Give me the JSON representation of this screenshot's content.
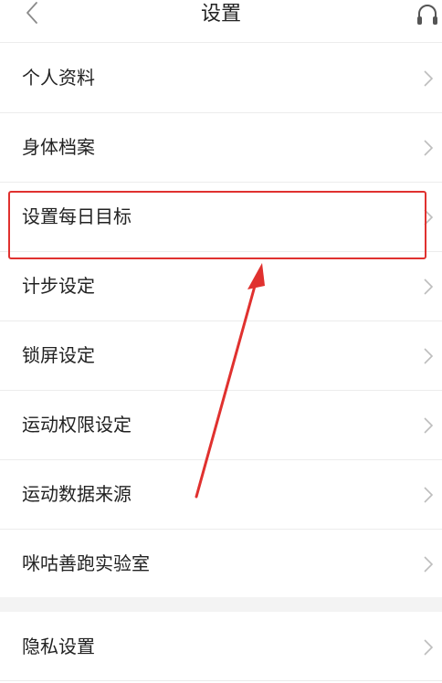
{
  "header": {
    "title": "设置",
    "back_icon": "chevron-left-icon",
    "support_icon": "headset-icon"
  },
  "settings": {
    "items": [
      {
        "label": "个人资料"
      },
      {
        "label": "身体档案"
      },
      {
        "label": "设置每日目标"
      },
      {
        "label": "计步设定"
      },
      {
        "label": "锁屏设定"
      },
      {
        "label": "运动权限设定"
      },
      {
        "label": "运动数据来源"
      },
      {
        "label": "咪咕善跑实验室"
      }
    ]
  },
  "privacy": {
    "items": [
      {
        "label": "隐私设置"
      }
    ]
  },
  "annotation": {
    "highlight_color": "#e0312f",
    "highlighted_item": "设置每日目标"
  },
  "colors": {
    "background": "#ffffff",
    "section_gap": "#f3f3f3",
    "divider": "#ececec",
    "chevron": "#bdbdbd",
    "text": "#222222"
  }
}
